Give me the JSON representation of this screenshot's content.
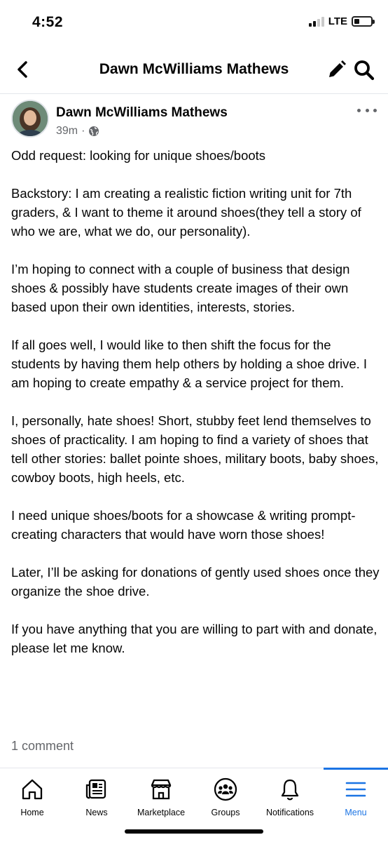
{
  "status": {
    "time": "4:52",
    "network": "LTE",
    "battery_level": 0.3
  },
  "nav": {
    "title": "Dawn McWilliams Mathews"
  },
  "post": {
    "author": "Dawn McWilliams Mathews",
    "time": "39m",
    "privacy_icon": "globe-icon",
    "paragraphs": [
      "Odd request: looking for unique shoes/boots",
      "Backstory: I am creating a realistic fiction writing unit for 7th graders, & I want to theme it around shoes(they tell a story of who we are, what we do, our personality).",
      "I’m hoping to connect with a couple of business that design shoes & possibly have students create images of their own based upon their own identities, interests, stories.",
      "If all goes well, I would like to then shift the focus for the students by having them help others by holding a shoe drive. I am hoping to create empathy & a service project for them.",
      "I, personally, hate shoes! Short, stubby feet lend themselves to shoes of practicality. I am hoping to find a variety of shoes that tell other stories: ballet pointe shoes, military boots, baby shoes, cowboy boots, high heels, etc.",
      "I need unique shoes/boots for a showcase & writing prompt- creating characters that would have worn those shoes!",
      "Later, I’ll be asking for donations of gently used shoes once they organize the shoe drive.",
      "If you have anything that you are willing to part with and donate, please let me know."
    ],
    "comments": "1 comment"
  },
  "tabs": [
    {
      "label": "Home",
      "icon": "home-icon"
    },
    {
      "label": "News",
      "icon": "news-icon"
    },
    {
      "label": "Marketplace",
      "icon": "marketplace-icon"
    },
    {
      "label": "Groups",
      "icon": "groups-icon"
    },
    {
      "label": "Notifications",
      "icon": "bell-icon"
    },
    {
      "label": "Menu",
      "icon": "menu-icon",
      "active": true
    }
  ],
  "colors": {
    "accent": "#1b74e4",
    "secondary_text": "#65676b"
  }
}
